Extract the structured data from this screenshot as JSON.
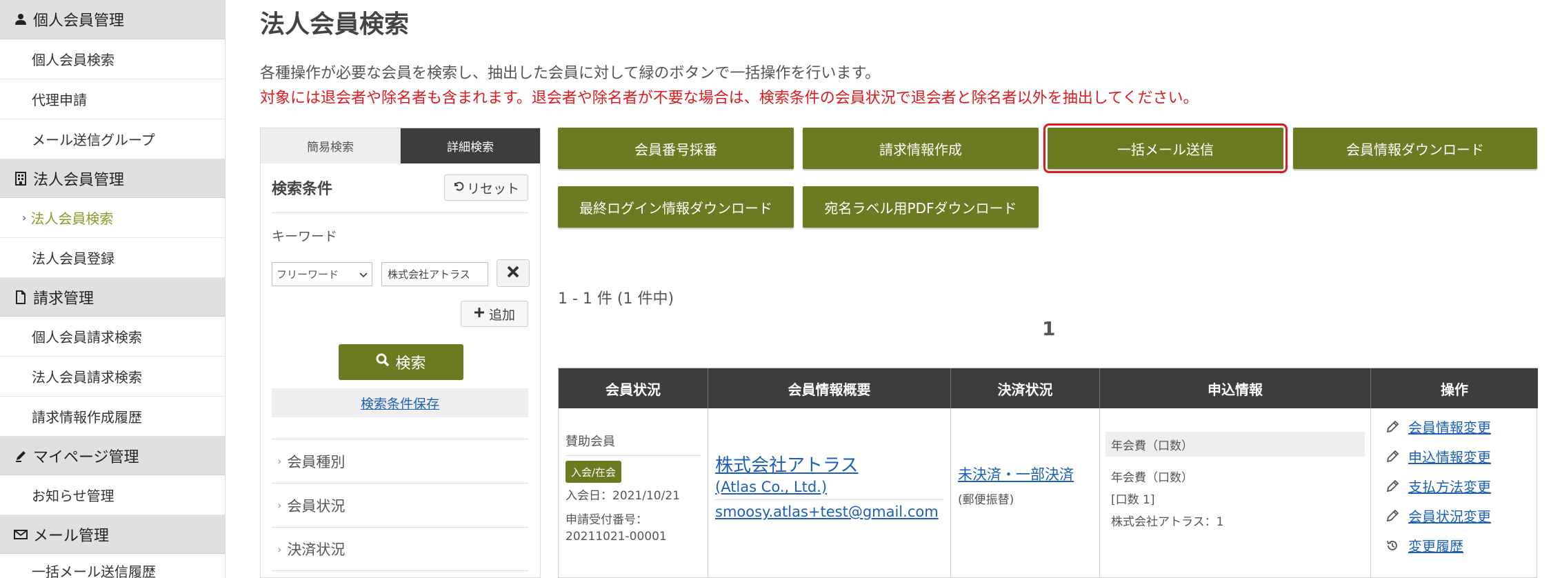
{
  "sidebar": {
    "sections": [
      {
        "label": "個人会員管理",
        "icon": "person-icon",
        "items": [
          "個人会員検索",
          "代理申請",
          "メール送信グループ"
        ]
      },
      {
        "label": "法人会員管理",
        "icon": "building-icon",
        "items": [
          "法人会員検索",
          "法人会員登録"
        ]
      },
      {
        "label": "請求管理",
        "icon": "document-icon",
        "items": [
          "個人会員請求検索",
          "法人会員請求検索",
          "請求情報作成履歴"
        ]
      },
      {
        "label": "マイページ管理",
        "icon": "pen-icon",
        "items": [
          "お知らせ管理"
        ]
      },
      {
        "label": "メール管理",
        "icon": "mail-icon",
        "items": [
          "一括メール送信履歴"
        ]
      }
    ]
  },
  "page": {
    "title": "法人会員検索",
    "desc1": "各種操作が必要な会員を検索し、抽出した会員に対して緑のボタンで一括操作を行います。",
    "desc2": "対象には退会者や除名者も含まれます。退会者や除名者が不要な場合は、検索条件の会員状況で退会者と除名者以外を抽出してください。"
  },
  "search": {
    "tab_simple": "簡易検索",
    "tab_detail": "詳細検索",
    "heading": "検索条件",
    "reset": "リセット",
    "keyword_label": "キーワード",
    "keyword_select": "フリーワード",
    "keyword_value": "株式会社アトラス",
    "add": "追加",
    "search_btn": "検索",
    "save_cond": "検索条件保存",
    "accordions": [
      "会員種別",
      "会員状況",
      "決済状況"
    ]
  },
  "actions": {
    "member_number": "会員番号採番",
    "billing_create": "請求情報作成",
    "bulk_mail": "一括メール送信",
    "member_download": "会員情報ダウンロード",
    "last_login_download": "最終ログイン情報ダウンロード",
    "label_pdf_download": "宛名ラベル用PDFダウンロード"
  },
  "results": {
    "count": "1 - 1 件 (1 件中)",
    "page": "1"
  },
  "table": {
    "headers": [
      "会員状況",
      "会員情報概要",
      "決済状況",
      "申込情報",
      "操作"
    ],
    "row": {
      "status_type": "賛助会員",
      "badge": "入会/在会",
      "join_date": "入会日：2021/10/21",
      "receipt_label": "申請受付番号：",
      "receipt_no": "20211021-00001",
      "company_name": "株式会社アトラス",
      "company_en": "(Atlas Co., Ltd.)",
      "email": "smoosy.atlas+test@gmail.com",
      "payment_status": "未決済・一部決済",
      "payment_method": "(郵便振替)",
      "app_head": "年会費（口数）",
      "app_line1": "年会費（口数）",
      "app_line2": "[口数 1]",
      "app_line3": "株式会社アトラス：1",
      "ops": [
        "会員情報変更",
        "申込情報変更",
        "支払方法変更",
        "会員状況変更",
        "変更履歴"
      ]
    }
  },
  "colors": {
    "accent": "#6e7a22",
    "warning": "#e0191f",
    "link": "#1c5fb8",
    "header_dark": "#3d3d3d"
  }
}
